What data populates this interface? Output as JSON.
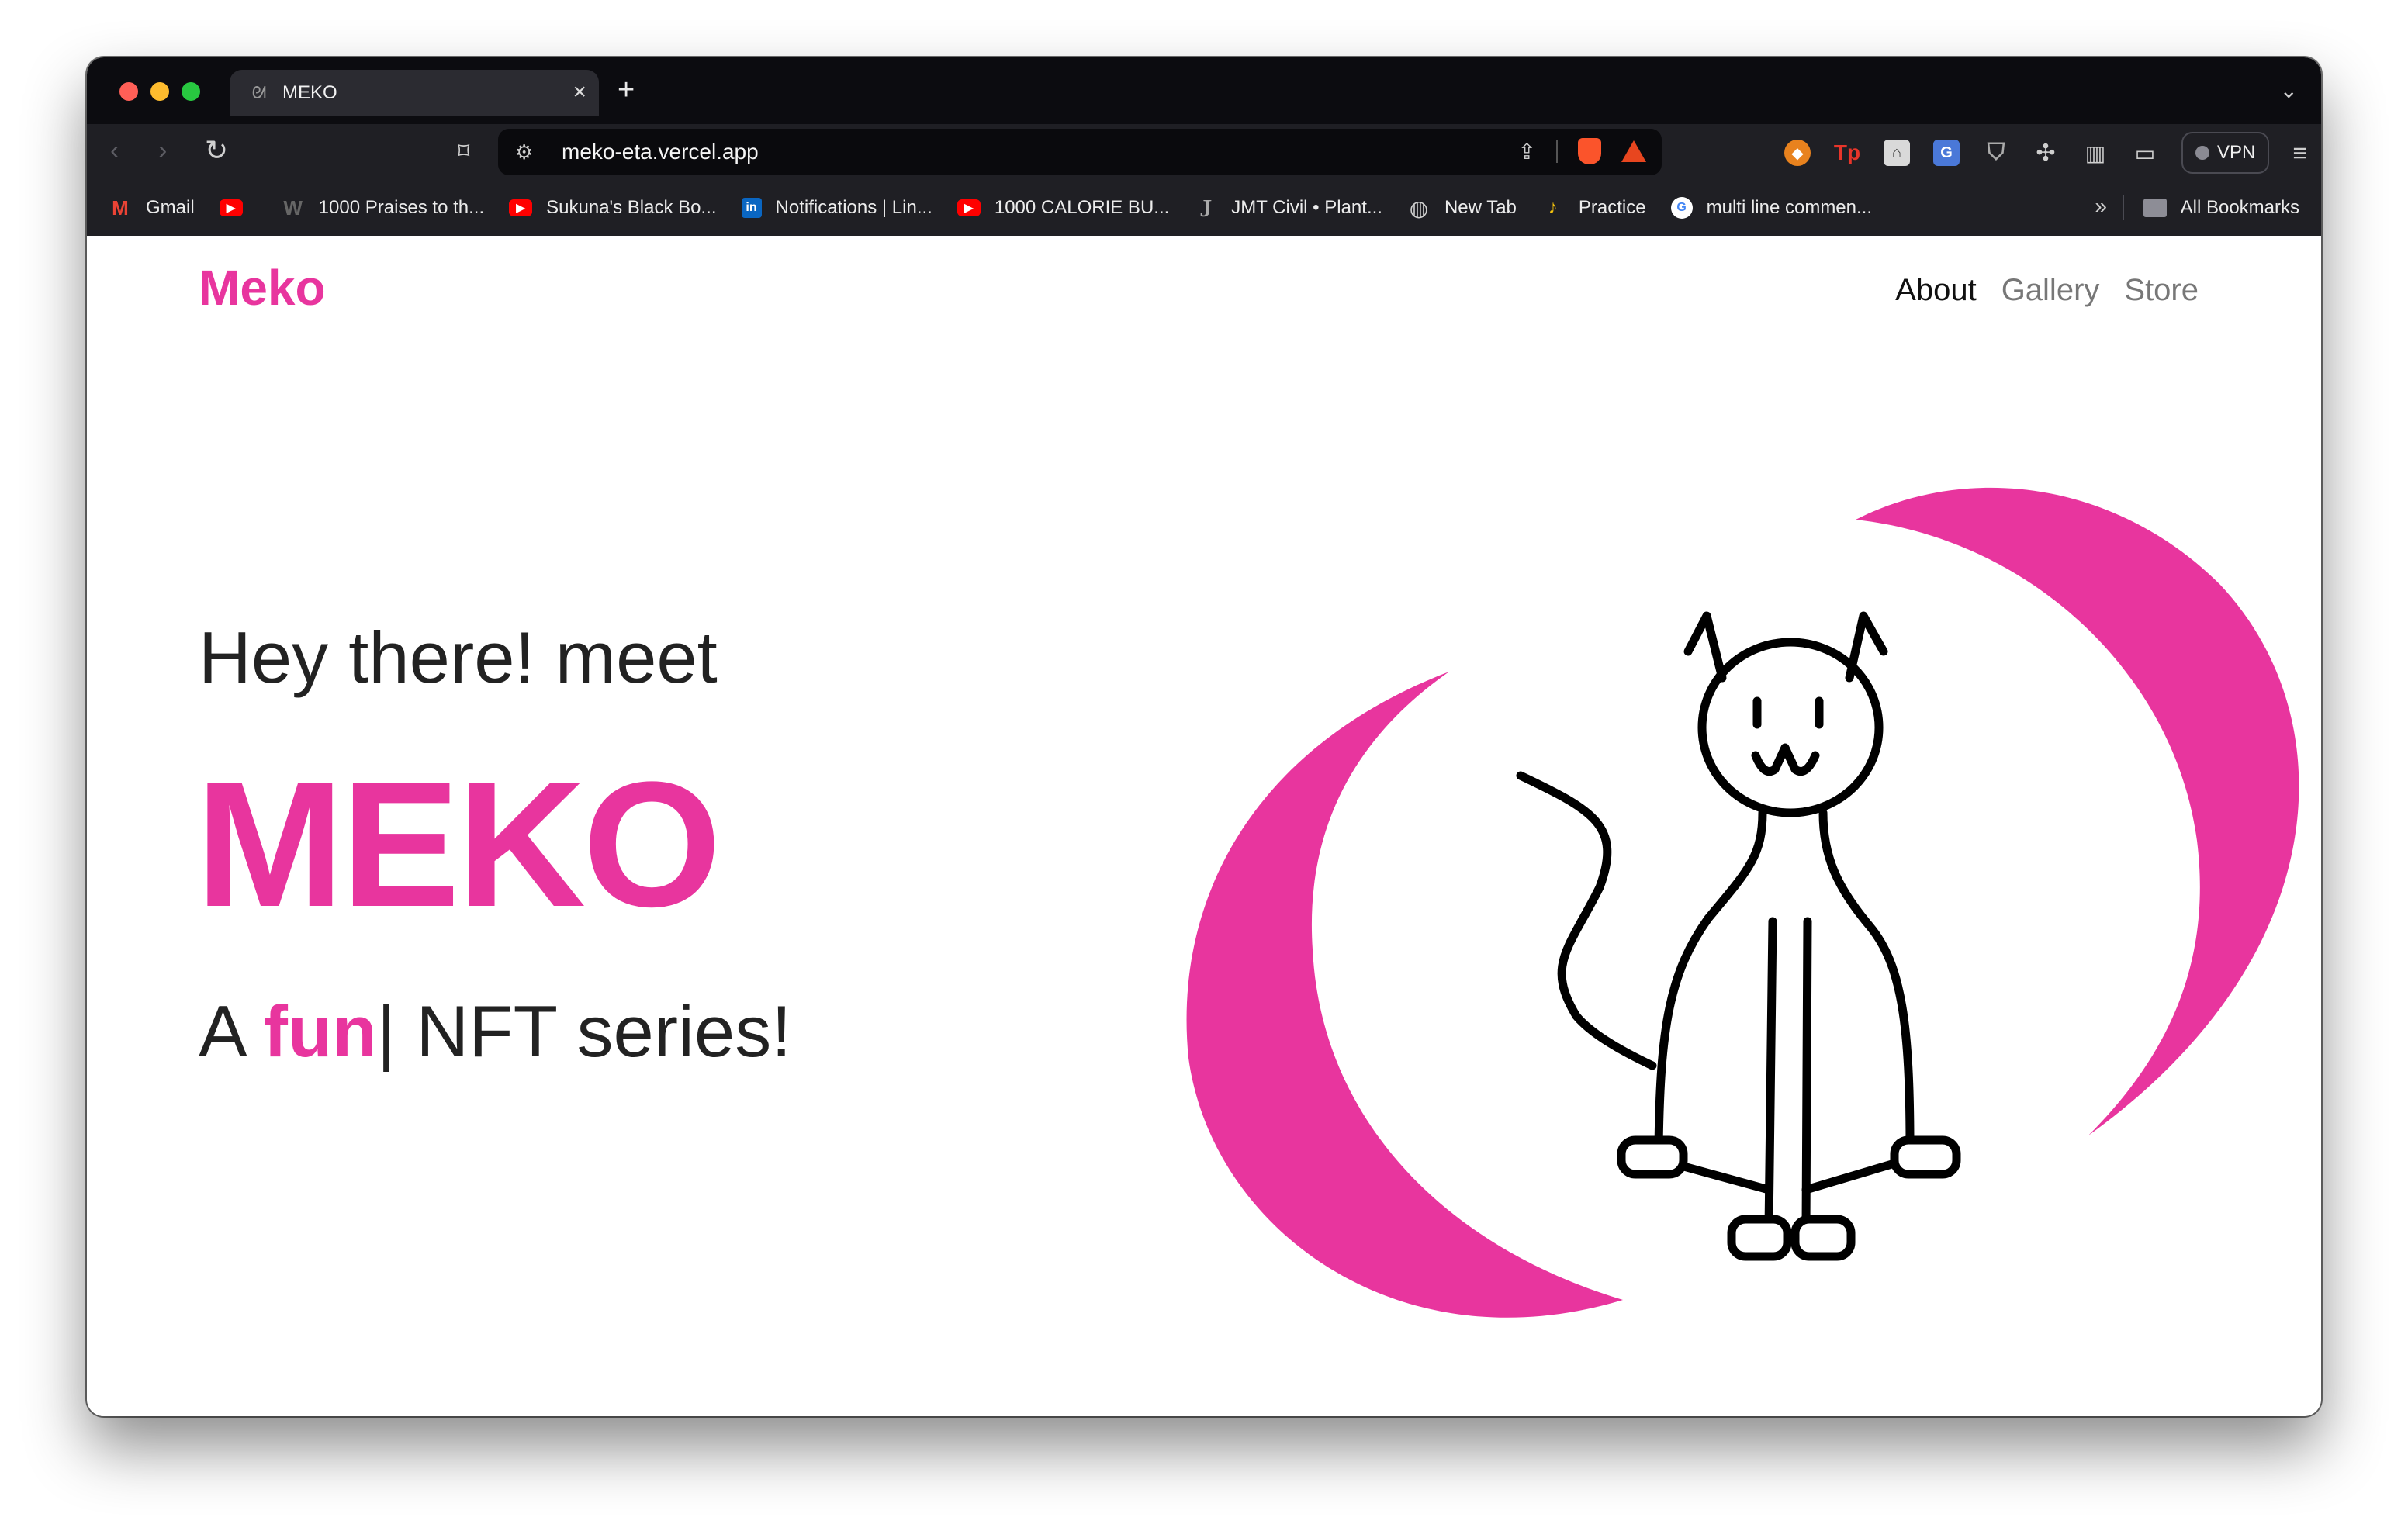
{
  "browser": {
    "tab_title": "MEKO",
    "new_tab": "+",
    "close": "×",
    "url": "meko-eta.vercel.app",
    "vpn_label": "VPN",
    "ext_tp": "Tp",
    "bookmarks": [
      {
        "label": "Gmail",
        "icon": "gmail-icon"
      },
      {
        "label": "",
        "icon": "youtube-icon"
      },
      {
        "label": "1000 Praises to th...",
        "icon": "w-icon"
      },
      {
        "label": "Sukuna's Black Bo...",
        "icon": "youtube-icon"
      },
      {
        "label": "Notifications | Lin...",
        "icon": "linkedin-icon"
      },
      {
        "label": "1000 CALORIE BU...",
        "icon": "youtube-icon"
      },
      {
        "label": "JMT Civil • Plant...",
        "icon": "j-icon"
      },
      {
        "label": "New Tab",
        "icon": "globe-icon"
      },
      {
        "label": "Practice",
        "icon": "bell-icon"
      },
      {
        "label": "multi line commen...",
        "icon": "google-icon"
      }
    ],
    "more_bookmarks": "»",
    "all_bookmarks": "All Bookmarks"
  },
  "site": {
    "brand": "Meko",
    "nav": [
      "About",
      "Gallery",
      "Store"
    ],
    "intro": "Hey there! meet",
    "title": "MEKO",
    "tagline_prefix": "A ",
    "tagline_accent": "fun",
    "tagline_cursor": "|",
    "tagline_suffix": " NFT series!"
  },
  "colors": {
    "accent": "#e8359e",
    "text": "#222222"
  }
}
